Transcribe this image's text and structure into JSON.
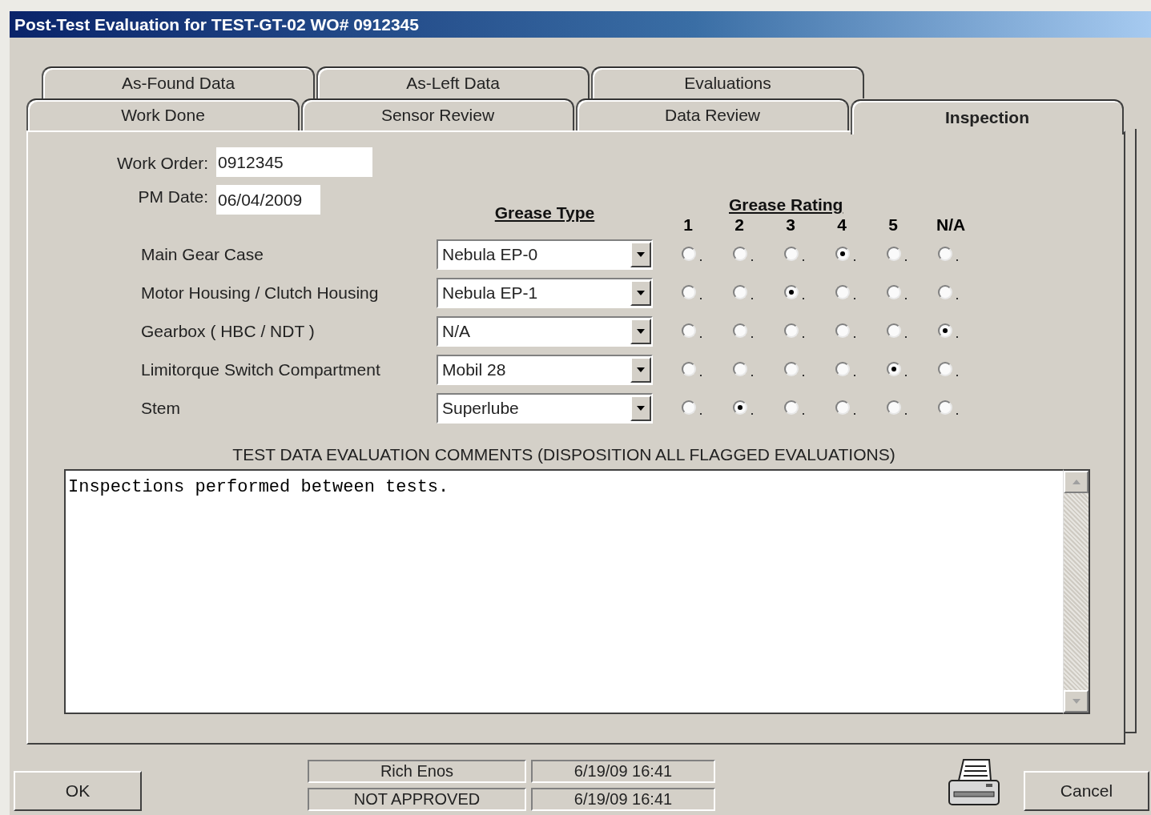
{
  "window": {
    "title": "Post-Test Evaluation for TEST-GT-02 WO# 0912345"
  },
  "tabs": {
    "back_row": [
      {
        "label": "As-Found Data",
        "selected": false
      },
      {
        "label": "As-Left Data",
        "selected": false
      },
      {
        "label": "Evaluations",
        "selected": false
      }
    ],
    "front_row": [
      {
        "label": "Work Done",
        "selected": false
      },
      {
        "label": "Sensor Review",
        "selected": false
      },
      {
        "label": "Data Review",
        "selected": false
      },
      {
        "label": "Inspection",
        "selected": true
      }
    ]
  },
  "work_order": {
    "label": "Work Order:",
    "value": "0912345"
  },
  "pm_date": {
    "label": "PM Date:",
    "value": "06/04/2009"
  },
  "grease": {
    "type_header": "Grease Type",
    "rating_header": "Grease Rating",
    "rating_columns": [
      "1",
      "2",
      "3",
      "4",
      "5",
      "N/A"
    ],
    "rows": [
      {
        "label": "Main Gear Case",
        "grease_type": "Nebula EP-0",
        "ratings": [
          false,
          false,
          false,
          true,
          false,
          false
        ]
      },
      {
        "label": "Motor Housing / Clutch Housing",
        "grease_type": "Nebula EP-1",
        "ratings": [
          false,
          false,
          true,
          false,
          false,
          false
        ]
      },
      {
        "label": "Gearbox ( HBC / NDT )",
        "grease_type": "N/A",
        "ratings": [
          false,
          false,
          false,
          false,
          false,
          true
        ]
      },
      {
        "label": "Limitorque Switch Compartment",
        "grease_type": "Mobil 28",
        "ratings": [
          false,
          false,
          false,
          false,
          true,
          false
        ]
      },
      {
        "label": "Stem",
        "grease_type": "Superlube",
        "ratings": [
          false,
          true,
          false,
          false,
          false,
          false
        ]
      }
    ]
  },
  "comments": {
    "label": "TEST DATA EVALUATION COMMENTS (DISPOSITION ALL FLAGGED EVALUATIONS)",
    "text": "Inspections performed between tests."
  },
  "status": [
    {
      "text": "Rich Enos"
    },
    {
      "text": "6/19/09 16:41"
    },
    {
      "text": "NOT APPROVED"
    },
    {
      "text": "6/19/09 16:41"
    }
  ],
  "buttons": {
    "ok": "OK",
    "cancel": "Cancel"
  }
}
